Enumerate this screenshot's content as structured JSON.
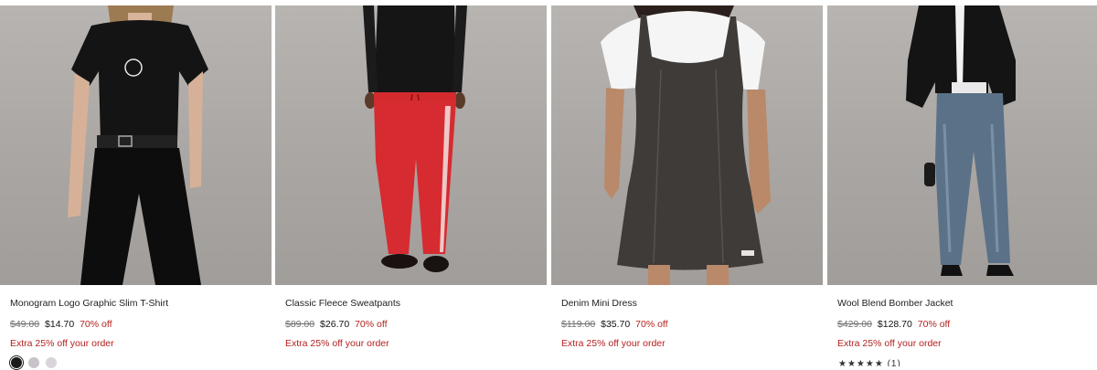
{
  "products": [
    {
      "name": "Monogram Logo Graphic Slim T-Shirt",
      "orig_price": "$49.00",
      "sale_price": "$14.70",
      "discount": "70% off",
      "promo": "Extra 25% off your order",
      "logo_text": "CK",
      "swatch_colors": [
        "#1a1a1a",
        "#c7c3c8",
        "#d9d4da"
      ]
    },
    {
      "name": "Classic Fleece Sweatpants",
      "orig_price": "$89.00",
      "sale_price": "$26.70",
      "discount": "70% off",
      "promo": "Extra 25% off your order"
    },
    {
      "name": "Denim Mini Dress",
      "orig_price": "$119.00",
      "sale_price": "$35.70",
      "discount": "70% off",
      "promo": "Extra 25% off your order"
    },
    {
      "name": "Wool Blend Bomber Jacket",
      "orig_price": "$429.00",
      "sale_price": "$128.70",
      "discount": "70% off",
      "promo": "Extra 25% off your order",
      "rating": "★★★★★ (1)"
    }
  ],
  "colors": {
    "discount": "#b3201f",
    "background_photo": "#aeaaa7"
  }
}
